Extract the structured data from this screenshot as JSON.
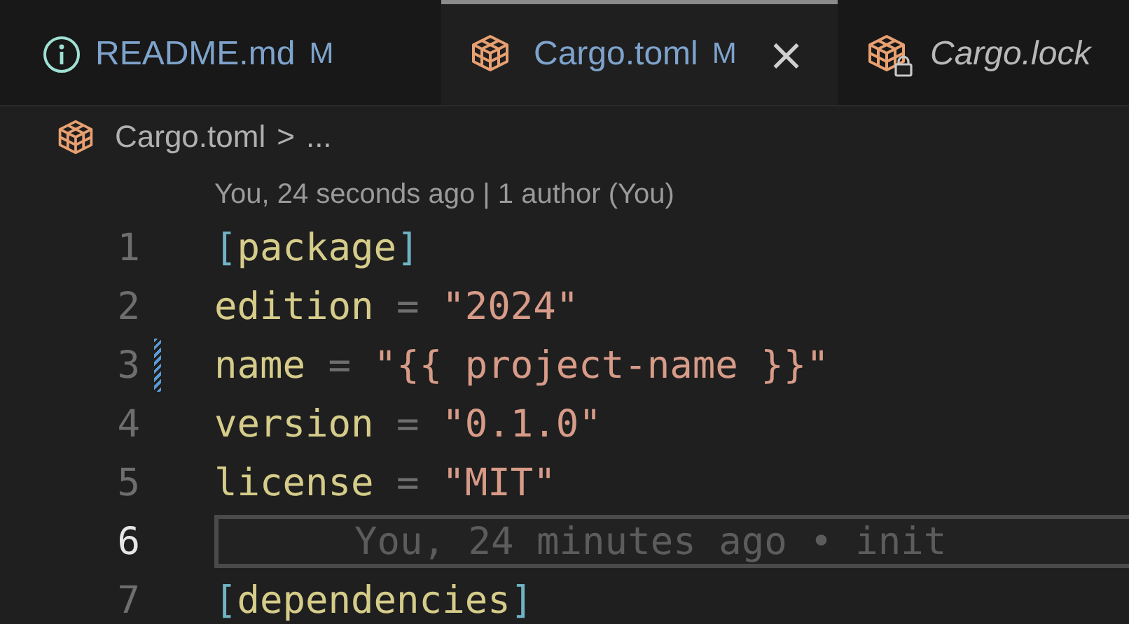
{
  "tabs": [
    {
      "label": "README.md",
      "kind": "info",
      "status": "M",
      "selected": false,
      "preview": false
    },
    {
      "label": "Cargo.toml",
      "kind": "package",
      "status": "M",
      "selected": true,
      "preview": false,
      "close": "×"
    },
    {
      "label": "Cargo.lock",
      "kind": "locked-package",
      "selected": false,
      "preview": true
    }
  ],
  "breadcrumb": {
    "file": "Cargo.toml",
    "separator": ">",
    "rest": "..."
  },
  "codelens": "You, 24 seconds ago | 1 author (You)",
  "lines": [
    {
      "number": "1",
      "modified": false,
      "current": false,
      "tokens": [
        {
          "kind": "bracket",
          "text": "["
        },
        {
          "kind": "key",
          "text": "package"
        },
        {
          "kind": "bracket",
          "text": "]"
        }
      ]
    },
    {
      "number": "2",
      "modified": false,
      "current": false,
      "tokens": [
        {
          "kind": "key",
          "text": "edition"
        },
        {
          "kind": "op",
          "text": " = "
        },
        {
          "kind": "string",
          "text": "\"2024\""
        }
      ]
    },
    {
      "number": "3",
      "modified": true,
      "current": false,
      "tokens": [
        {
          "kind": "key",
          "text": "name"
        },
        {
          "kind": "op",
          "text": " = "
        },
        {
          "kind": "string",
          "text": "\"{{ project-name }}\""
        }
      ]
    },
    {
      "number": "4",
      "modified": false,
      "current": false,
      "tokens": [
        {
          "kind": "key",
          "text": "version"
        },
        {
          "kind": "op",
          "text": " = "
        },
        {
          "kind": "string",
          "text": "\"0.1.0\""
        }
      ]
    },
    {
      "number": "5",
      "modified": false,
      "current": false,
      "tokens": [
        {
          "kind": "key",
          "text": "license"
        },
        {
          "kind": "op",
          "text": " = "
        },
        {
          "kind": "string",
          "text": "\"MIT\""
        }
      ]
    },
    {
      "number": "6",
      "modified": false,
      "current": true,
      "blame": "You, 24 minutes ago • init"
    },
    {
      "number": "7",
      "modified": false,
      "current": false,
      "tokens": [
        {
          "kind": "bracket",
          "text": "["
        },
        {
          "kind": "key",
          "text": "dependencies"
        },
        {
          "kind": "bracket",
          "text": "]"
        }
      ]
    }
  ]
}
